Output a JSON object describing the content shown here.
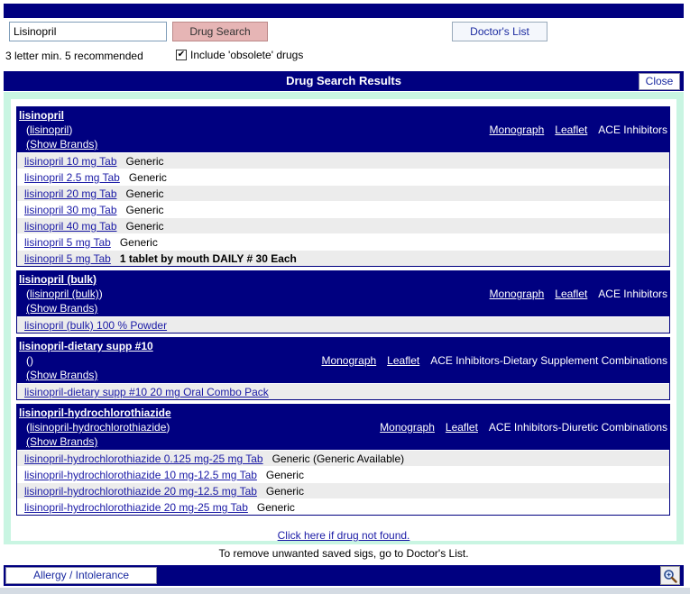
{
  "search": {
    "value": "Lisinopril",
    "button_label": "Drug Search",
    "hint": "3 letter min. 5 recommended",
    "obsolete_label": "Include 'obsolete' drugs",
    "obsolete_checked": "✔"
  },
  "toolbar": {
    "doctors_list_label": "Doctor's List"
  },
  "results": {
    "title": "Drug Search Results",
    "close_label": "Close",
    "not_found_link": "Click here if drug not found.",
    "groups": [
      {
        "name": "lisinopril",
        "sub": "lisinopril",
        "show_brands": "(Show Brands)",
        "monograph": "Monograph",
        "leaflet": "Leaflet",
        "class": "ACE Inhibitors",
        "items": [
          {
            "link": "lisinopril 10 mg Tab",
            "note": "Generic"
          },
          {
            "link": "lisinopril 2.5 mg Tab",
            "note": "Generic"
          },
          {
            "link": "lisinopril 20 mg Tab",
            "note": "Generic"
          },
          {
            "link": "lisinopril 30 mg Tab",
            "note": "Generic"
          },
          {
            "link": "lisinopril 40 mg Tab",
            "note": "Generic"
          },
          {
            "link": "lisinopril 5 mg Tab",
            "note": "Generic"
          },
          {
            "link": "lisinopril 5 mg Tab",
            "note": "1 tablet by mouth DAILY # 30 Each"
          }
        ]
      },
      {
        "name": "lisinopril (bulk)",
        "sub": "lisinopril (bulk)",
        "show_brands": "(Show Brands)",
        "monograph": "Monograph",
        "leaflet": "Leaflet",
        "class": "ACE Inhibitors",
        "items": [
          {
            "link": "lisinopril (bulk) 100 % Powder",
            "note": ""
          }
        ]
      },
      {
        "name": "lisinopril-dietary supp #10",
        "sub": "()",
        "show_brands": "(Show Brands)",
        "monograph": "Monograph",
        "leaflet": "Leaflet",
        "class": "ACE Inhibitors-Dietary Supplement Combinations",
        "items": [
          {
            "link": "lisinopril-dietary supp #10 20 mg Oral Combo Pack",
            "note": ""
          }
        ]
      },
      {
        "name": "lisinopril-hydrochlorothiazide",
        "sub": "lisinopril-hydrochlorothiazide",
        "show_brands": "(Show Brands)",
        "monograph": "Monograph",
        "leaflet": "Leaflet",
        "class": "ACE Inhibitors-Diuretic Combinations",
        "items": [
          {
            "link": "lisinopril-hydrochlorothiazide 0.125 mg-25 mg Tab",
            "note": "Generic (Generic Available)"
          },
          {
            "link": "lisinopril-hydrochlorothiazide 10 mg-12.5 mg Tab",
            "note": "Generic"
          },
          {
            "link": "lisinopril-hydrochlorothiazide 20 mg-12.5 mg Tab",
            "note": "Generic"
          },
          {
            "link": "lisinopril-hydrochlorothiazide 20 mg-25 mg Tab",
            "note": "Generic"
          }
        ]
      }
    ]
  },
  "footer": {
    "note": "To remove unwanted saved sigs, go to Doctor's List.",
    "allergy_label": "Allergy / Intolerance",
    "zoom_icon": "magnifier-icon"
  },
  "colors": {
    "header_navy": "#000080",
    "frame_mint": "#c9f5e2",
    "search_button": "#e6b5b5",
    "link_blue": "#1a1aa6"
  }
}
